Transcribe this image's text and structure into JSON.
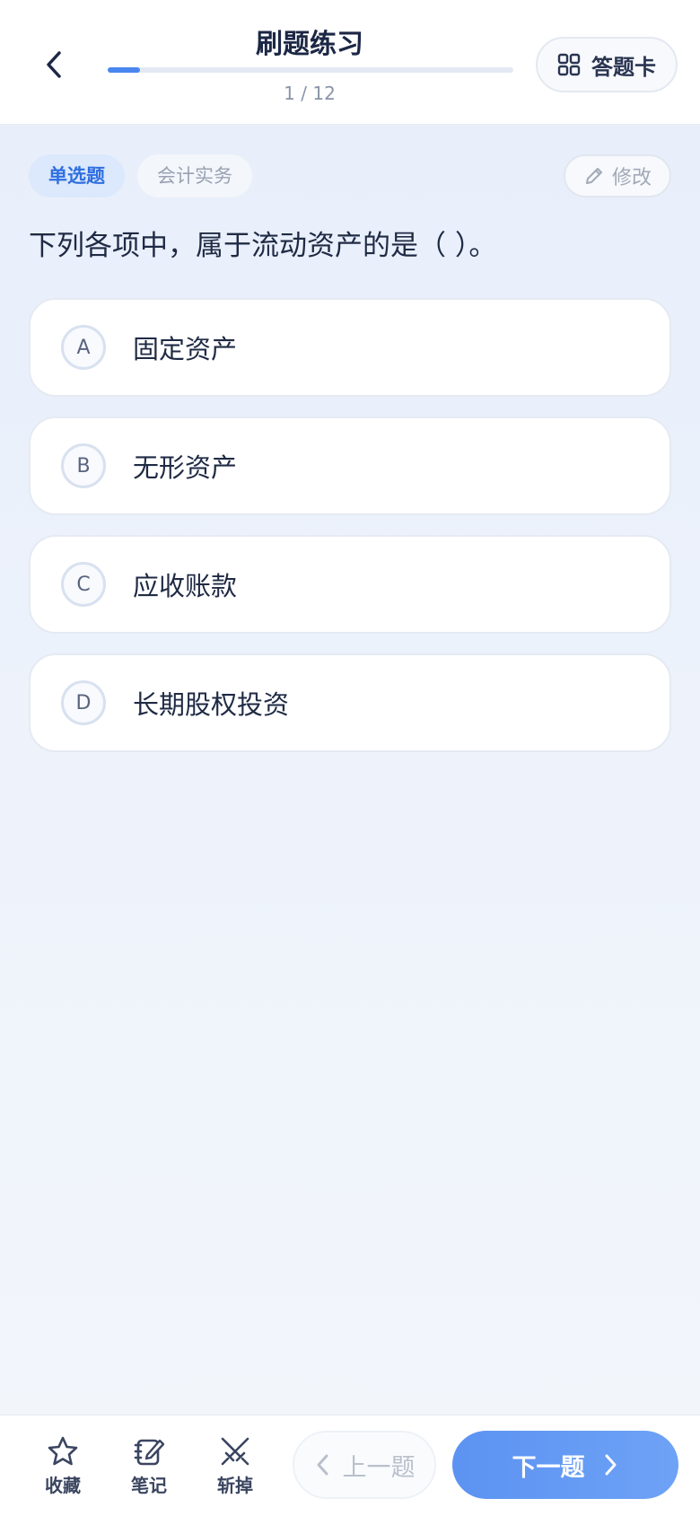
{
  "header": {
    "title": "刷题练习",
    "progress_text": "1 / 12",
    "progress": 0.08,
    "answer_card_label": "答题卡"
  },
  "question": {
    "type_tag": "单选题",
    "subject_tag": "会计实务",
    "edit_label": "修改",
    "text": "下列各项中，属于流动资产的是（ ）。",
    "options": [
      {
        "letter": "A",
        "text": "固定资产"
      },
      {
        "letter": "B",
        "text": "无形资产"
      },
      {
        "letter": "C",
        "text": "应收账款"
      },
      {
        "letter": "D",
        "text": "长期股权投资"
      }
    ]
  },
  "bottom": {
    "favorite_label": "收藏",
    "note_label": "笔记",
    "remove_label": "斩掉",
    "prev_label": "上一题",
    "next_label": "下一题"
  },
  "colors": {
    "accent": "#4a86f0",
    "next_button": "#6ea2f6",
    "tag_bg": "#dce8fc"
  },
  "icons": [
    "chevron-left-icon",
    "grid-icon",
    "pencil-icon",
    "star-icon",
    "notebook-icon",
    "swords-icon",
    "chevron-right-icon"
  ]
}
